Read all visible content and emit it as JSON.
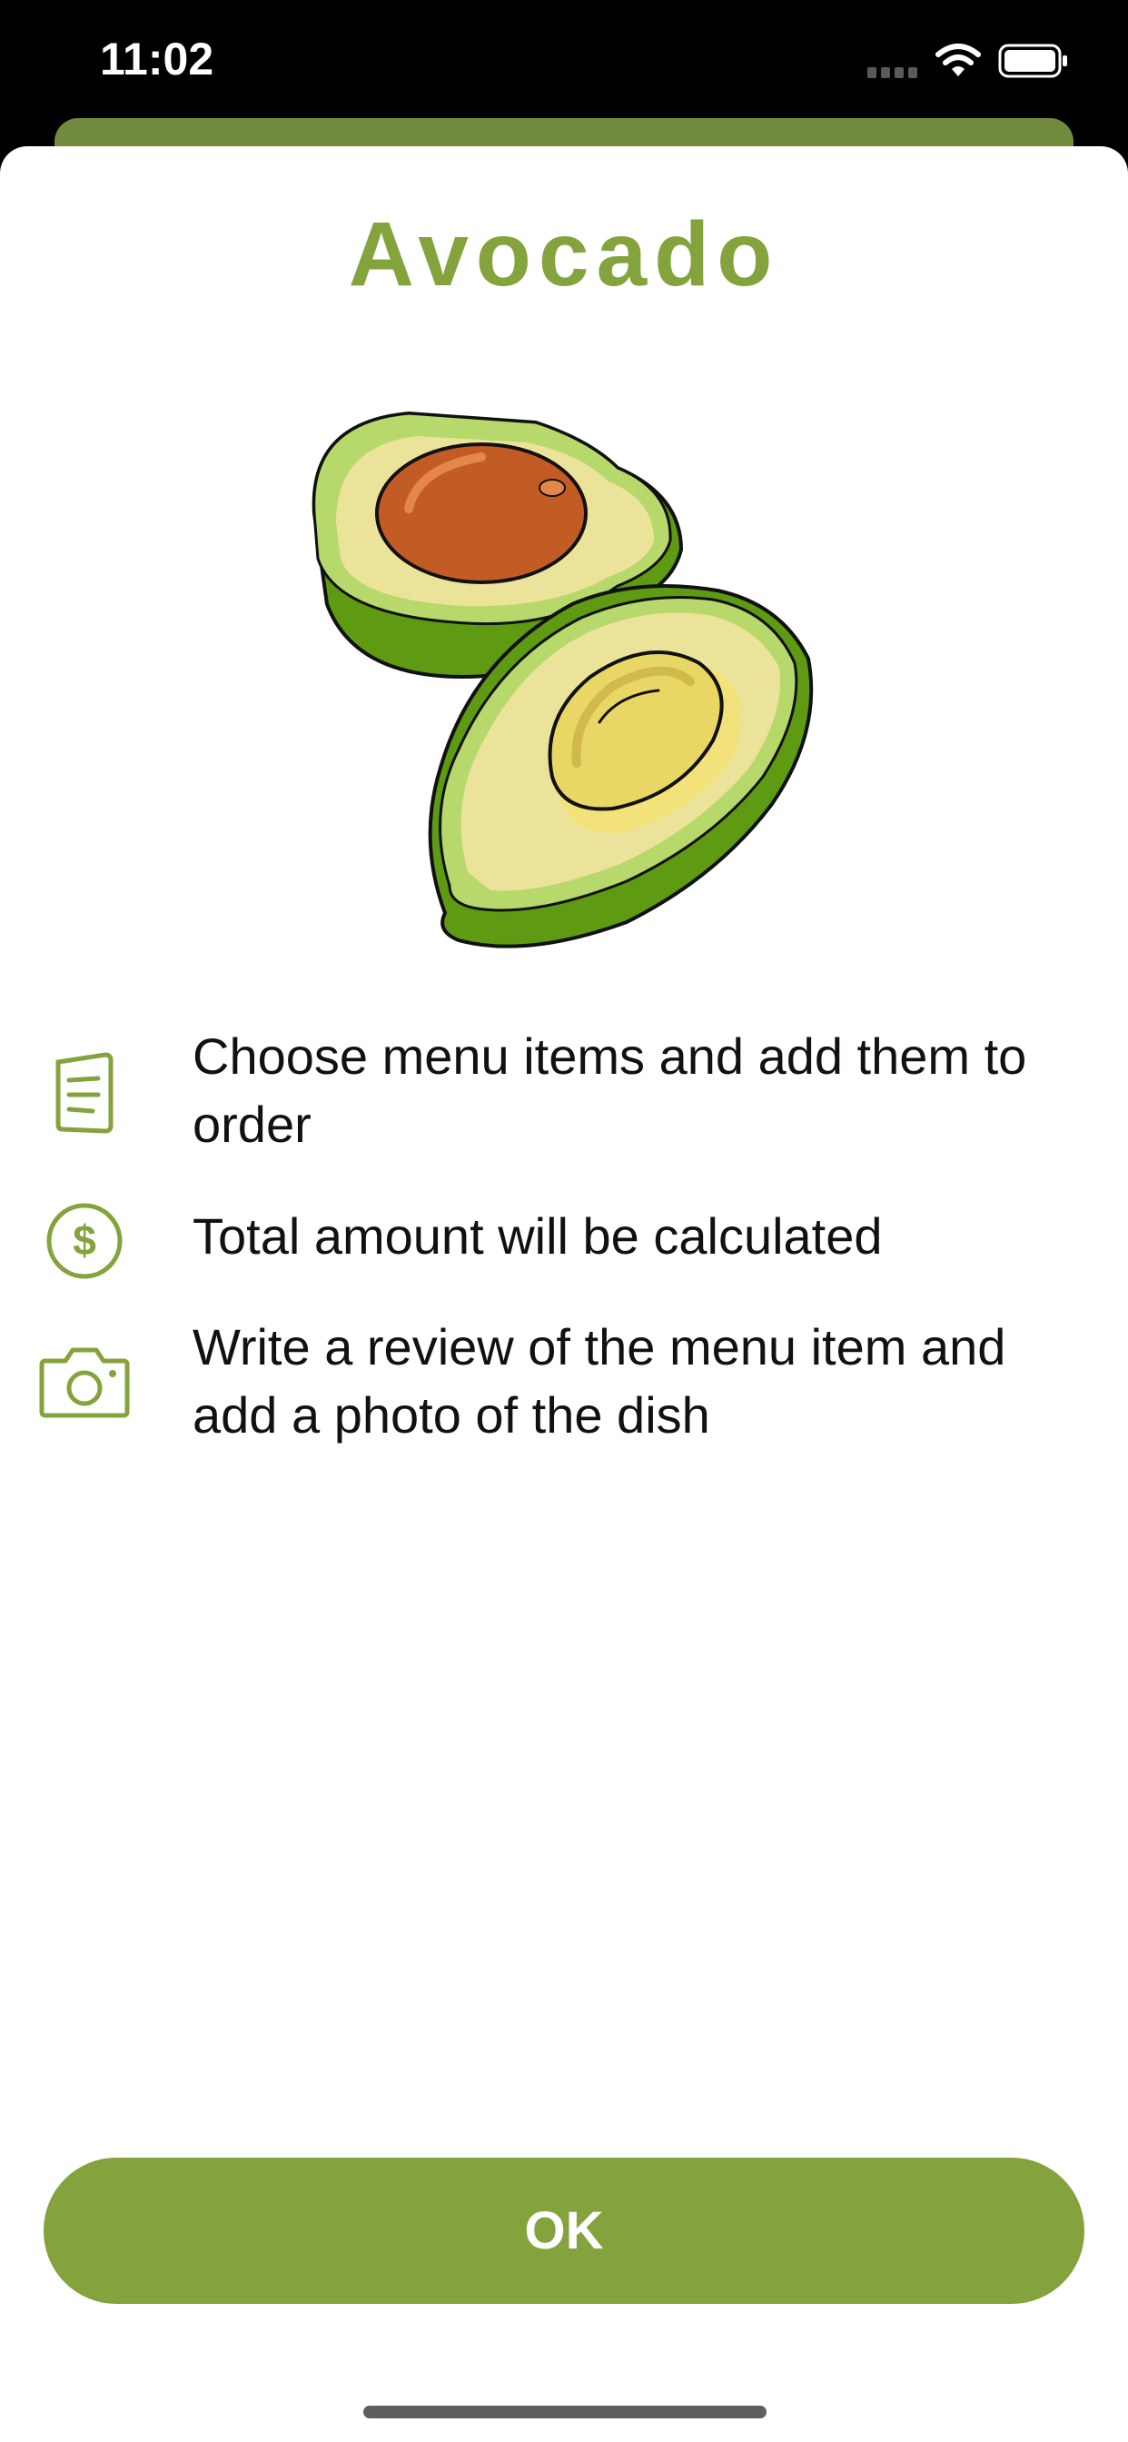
{
  "status_bar": {
    "time": "11:02"
  },
  "sheet": {
    "title": "Avocado",
    "image": "avocado-illustration"
  },
  "features": [
    {
      "icon": "menu-icon",
      "text": "Choose menu items and add them to order"
    },
    {
      "icon": "dollar-icon",
      "text": "Total amount will be calculated"
    },
    {
      "icon": "camera-icon",
      "text": "Write a review of the menu item and add a photo of the dish"
    }
  ],
  "actions": {
    "ok_label": "OK"
  },
  "colors": {
    "accent": "#84a33d",
    "sheet_behind": "#728a3d",
    "background": "#ffffff",
    "text": "#111111"
  }
}
